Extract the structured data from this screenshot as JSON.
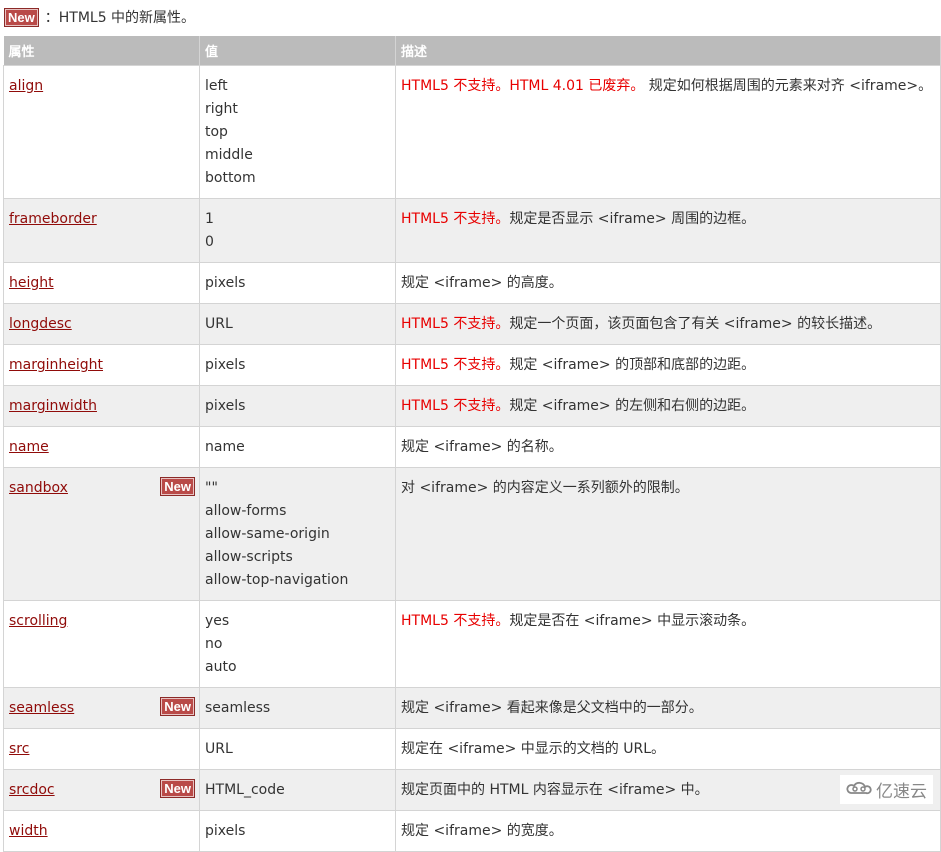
{
  "legend": {
    "badge": "New",
    "text": "：HTML5 中的新属性。"
  },
  "table": {
    "headers": [
      "属性",
      "值",
      "描述"
    ],
    "rows": [
      {
        "attr": "align",
        "new": false,
        "values": [
          "left",
          "right",
          "top",
          "middle",
          "bottom"
        ],
        "warn": "HTML5 不支持。HTML 4.01 已废弃。",
        "desc": " 规定如何根据周围的元素来对齐 <iframe>。"
      },
      {
        "attr": "frameborder",
        "new": false,
        "values": [
          "1",
          "0"
        ],
        "warn": "HTML5 不支持。",
        "desc": "规定是否显示 <iframe> 周围的边框。"
      },
      {
        "attr": "height",
        "new": false,
        "values": [
          "pixels"
        ],
        "warn": "",
        "desc": "规定 <iframe> 的高度。"
      },
      {
        "attr": "longdesc",
        "new": false,
        "values": [
          "URL"
        ],
        "warn": "HTML5 不支持。",
        "desc": "规定一个页面，该页面包含了有关 <iframe> 的较长描述。"
      },
      {
        "attr": "marginheight",
        "new": false,
        "values": [
          "pixels"
        ],
        "warn": "HTML5 不支持。",
        "desc": "规定 <iframe> 的顶部和底部的边距。"
      },
      {
        "attr": "marginwidth",
        "new": false,
        "values": [
          "pixels"
        ],
        "warn": "HTML5 不支持。",
        "desc": "规定 <iframe> 的左侧和右侧的边距。"
      },
      {
        "attr": "name",
        "new": false,
        "values": [
          "name"
        ],
        "warn": "",
        "desc": "规定 <iframe> 的名称。"
      },
      {
        "attr": "sandbox",
        "new": true,
        "values": [
          "\"\"",
          "allow-forms",
          "allow-same-origin",
          "allow-scripts",
          "allow-top-navigation"
        ],
        "warn": "",
        "desc": "对 <iframe> 的内容定义一系列额外的限制。"
      },
      {
        "attr": "scrolling",
        "new": false,
        "values": [
          "yes",
          "no",
          "auto"
        ],
        "warn": "HTML5 不支持。",
        "desc": "规定是否在 <iframe> 中显示滚动条。"
      },
      {
        "attr": "seamless",
        "new": true,
        "values": [
          "seamless"
        ],
        "warn": "",
        "desc": "规定 <iframe> 看起来像是父文档中的一部分。"
      },
      {
        "attr": "src",
        "new": false,
        "values": [
          "URL"
        ],
        "warn": "",
        "desc": "规定在 <iframe> 中显示的文档的 URL。"
      },
      {
        "attr": "srcdoc",
        "new": true,
        "values": [
          "HTML_code"
        ],
        "warn": "",
        "desc": "规定页面中的 HTML 内容显示在 <iframe> 中。"
      },
      {
        "attr": "width",
        "new": false,
        "values": [
          "pixels"
        ],
        "warn": "",
        "desc": "规定 <iframe> 的宽度。"
      }
    ]
  },
  "watermark": {
    "icon": "cloud-logo-icon",
    "text": "亿速云"
  },
  "colors": {
    "link": "#900b09",
    "warning": "#e80000",
    "header_bg": "#bbbbbb",
    "alt_row_bg": "#efefef",
    "badge_bg": "#b94a48"
  }
}
